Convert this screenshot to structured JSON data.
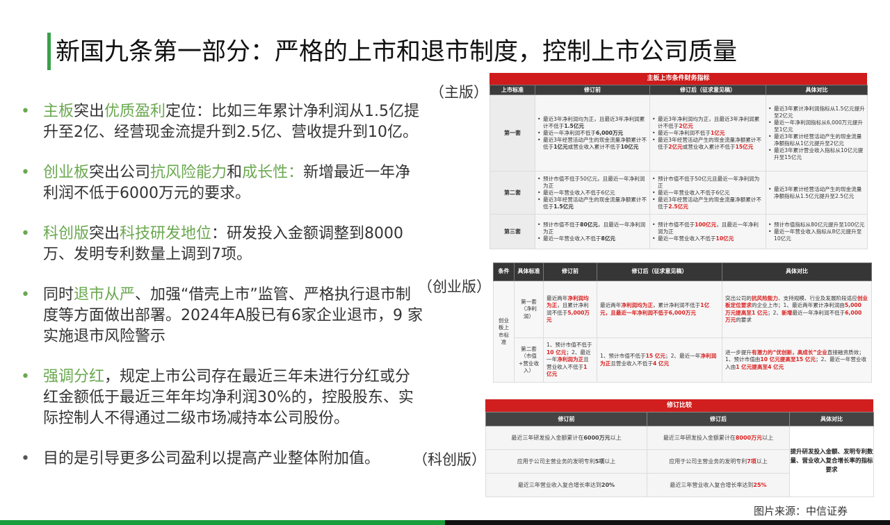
{
  "title": "新国九条第一部分：严格的上市和退市制度，控制上市公司质量",
  "bullets": [
    {
      "segments": [
        {
          "t": "主板",
          "hl": true
        },
        {
          "t": "突出",
          "hl": false
        },
        {
          "t": "优质盈利",
          "hl": true
        },
        {
          "t": "定位：比如三年累计净利润从1.5亿提升至2亿、经营现金流提升到2.5亿、营收提升到10亿。",
          "hl": false
        }
      ]
    },
    {
      "segments": [
        {
          "t": "创业板",
          "hl": true
        },
        {
          "t": "突出公司",
          "hl": false
        },
        {
          "t": "抗风险能力",
          "hl": true
        },
        {
          "t": "和",
          "hl": false
        },
        {
          "t": "成长性：",
          "hl": true
        },
        {
          "t": "新增最近一年净利润不低于6000万元的要求。",
          "hl": false
        }
      ]
    },
    {
      "segments": [
        {
          "t": "科创版",
          "hl": true
        },
        {
          "t": "突出",
          "hl": false
        },
        {
          "t": "科技研发地位",
          "hl": true
        },
        {
          "t": "：研发投入金额调整到8000万、发明专利数量上调到7项。",
          "hl": false
        }
      ]
    },
    {
      "segments": [
        {
          "t": "同时",
          "hl": false
        },
        {
          "t": "退市从严",
          "hl": true
        },
        {
          "t": "、加强“借壳上市”监管、严格执行退市制度等方面做出部署。2024年A股已有6家企业退市，9 家实施退市风险警示",
          "hl": false
        }
      ]
    },
    {
      "segments": [
        {
          "t": "强调分红",
          "hl": true
        },
        {
          "t": "，规定上市公司存在最近三年未进行分红或分红金额低于最近三年年均净利润30%的，控股股东、实际控制人不得通过二级市场减持本公司股份。",
          "hl": false
        }
      ]
    },
    {
      "plain": true,
      "segments": [
        {
          "t": "目的是引导更多公司盈利以提高产业整体附加值。",
          "hl": false
        }
      ]
    }
  ],
  "labels": {
    "main": "（主版）",
    "cyb": "（创业版）",
    "kcb": "（科创版）"
  },
  "source": "图片来源：中信证券",
  "colors": {
    "accent_green": "#6aa84f",
    "table_red": "#cf1b1b",
    "footer_green": "#1a9e3c"
  },
  "main_table": {
    "title": "主板上市条件财务指标",
    "headers": [
      "上市标准",
      "修订前",
      "修订后（征求意见稿）",
      "具体对比"
    ],
    "rows": [
      {
        "label": "第一套",
        "before": [
          [
            {
              "t": "最近3年净利润均为正，且最近3年净利润累计不低于"
            },
            {
              "t": "1.5亿元",
              "b": true
            }
          ],
          [
            {
              "t": "最近一年净利润不低于"
            },
            {
              "t": "6,000万元",
              "b": true
            }
          ],
          [
            {
              "t": "最近3年经营活动产生的现金流量净额累计不低于"
            },
            {
              "t": "1亿元",
              "b": true
            },
            {
              "t": "或营业收入累计不低于"
            },
            {
              "t": "10亿元",
              "b": true
            }
          ]
        ],
        "after": [
          [
            {
              "t": "最近3年净利润均为正，且最近3年净利润累计不低于"
            },
            {
              "t": "2亿元",
              "r": true
            }
          ],
          [
            {
              "t": "最近一年净利润不低于"
            },
            {
              "t": "1亿元",
              "r": true
            }
          ],
          [
            {
              "t": "最近3年经营活动产生的现金流量净额累计不低于"
            },
            {
              "t": "2亿元",
              "r": true
            },
            {
              "t": "或营业收入累计不低于"
            },
            {
              "t": "15亿元",
              "r": true
            }
          ]
        ],
        "compare": [
          "最近3年累计净利润指标从1.5亿元提升至2亿元",
          "最近一年净利润指标从6,000万元提升至1亿元",
          "最近3年累计经营活动产生的现金流量净额指标从1亿元提升至2亿元",
          "最近3年累计营业收入指标从10亿元提升至15亿元"
        ]
      },
      {
        "label": "第二套",
        "before": [
          [
            {
              "t": "预计市值不低于50亿元，且最近一年净利润为正"
            }
          ],
          [
            {
              "t": "最近一年营业收入不低于6亿元"
            }
          ],
          [
            {
              "t": "最近3年经营活动产生的现金流量净额累计不低于"
            },
            {
              "t": "1.5亿元",
              "b": true
            }
          ]
        ],
        "after": [
          [
            {
              "t": "预计市值不低于50亿元且最近一年净利润为正"
            }
          ],
          [
            {
              "t": "最近一年营业收入不低于6亿元"
            }
          ],
          [
            {
              "t": "最近3年经营活动产生的现金流量净额累计不低于"
            },
            {
              "t": "2.5亿元",
              "r": true
            }
          ]
        ],
        "compare": [
          "最近3年累计经营活动产生的现金流量净额指标从1.5亿元提升至2.5亿元"
        ]
      },
      {
        "label": "第三套",
        "before": [
          [
            {
              "t": "预计市值不低于"
            },
            {
              "t": "80亿元",
              "b": true
            },
            {
              "t": "，且最近一年净利润为正"
            }
          ],
          [
            {
              "t": "最近一年营业收入不低于"
            },
            {
              "t": "8亿元",
              "b": true
            }
          ]
        ],
        "after": [
          [
            {
              "t": "预计市值不低于"
            },
            {
              "t": "100亿元",
              "r": true
            },
            {
              "t": "，且最近一年净利润为正"
            }
          ],
          [
            {
              "t": "最近一年营业收入不低于"
            },
            {
              "t": "10亿元",
              "r": true
            }
          ]
        ],
        "compare": [
          "预计市值指标从80亿元提升至100亿元",
          "最近一年营业收入指标从8亿元提升至10亿元"
        ]
      }
    ]
  },
  "cyb_table": {
    "headers": [
      "条件",
      "具体标准",
      "修订前",
      "修订后（征求意见稿）",
      "具体对比"
    ],
    "condition": "创业板上市标准",
    "rows": [
      {
        "std": "第一套（净利润）",
        "before": [
          {
            "t": "最近两年"
          },
          {
            "t": "净利润均为正",
            "r": true
          },
          {
            "t": "，且累计净利润不低于"
          },
          {
            "t": "5,000万元",
            "r": true
          }
        ],
        "after": [
          {
            "t": "最近两年"
          },
          {
            "t": "净利润均为正",
            "r": true
          },
          {
            "t": "，累计净利润不低于"
          },
          {
            "t": "1亿元，且最近一年净利润不低于6,000万元",
            "r": true
          }
        ],
        "compare": [
          {
            "t": "突出公司的"
          },
          {
            "t": "抗风险能力",
            "r": true
          },
          {
            "t": "、支持规模、行业及发展阶段适应"
          },
          {
            "t": "创业板定位要求",
            "r": true
          },
          {
            "t": "的企业上市；1、最近两年累计净利润由"
          },
          {
            "t": "5,000 万元提高至1 亿元",
            "r": true
          },
          {
            "t": "；2、"
          },
          {
            "t": "新增",
            "r": true
          },
          {
            "t": "最近一年净利润不低于"
          },
          {
            "t": "6,000 万元",
            "r": true
          },
          {
            "t": "的要求"
          }
        ]
      },
      {
        "std": "第二套（市值+营业收入）",
        "before": [
          {
            "t": "1、预计市值不低于"
          },
          {
            "t": "10 亿元",
            "r": true
          },
          {
            "t": "；2、最近一年"
          },
          {
            "t": "净利润为正",
            "r": true
          },
          {
            "t": "且营业收入不低于"
          },
          {
            "t": "1 亿元",
            "r": true
          }
        ],
        "after": [
          {
            "t": "1、预计市值不低于"
          },
          {
            "t": "15 亿元",
            "r": true
          },
          {
            "t": "；2、最近一年"
          },
          {
            "t": "净利润为正",
            "r": true
          },
          {
            "t": "且营业收入不低于"
          },
          {
            "t": "4 亿元",
            "r": true
          }
        ],
        "compare": [
          {
            "t": "进一步提升"
          },
          {
            "t": "有潜力的“优创新，高成长”企业",
            "r": true
          },
          {
            "t": "直接融资质效；1、预计市值由"
          },
          {
            "t": "10 亿元提高至15 亿元",
            "r": true
          },
          {
            "t": "；2、最近一年营业收入由"
          },
          {
            "t": "1 亿元提高至4 亿元",
            "r": true
          }
        ]
      }
    ]
  },
  "kcb_table": {
    "title": "修订比较",
    "headers": [
      "修订前",
      "修订后",
      "具体对比"
    ],
    "rows": [
      {
        "before": [
          {
            "t": "最近三年研发投入金额累计在"
          },
          {
            "t": "6000万元",
            "b": true
          },
          {
            "t": "以上"
          }
        ],
        "after": [
          {
            "t": "最近三年研发投入金额累计在"
          },
          {
            "t": "8000万元",
            "r": true
          },
          {
            "t": "以上"
          }
        ]
      },
      {
        "before": [
          {
            "t": "应用于公司主营业务的发明专利"
          },
          {
            "t": "5项",
            "b": true
          },
          {
            "t": "以上"
          }
        ],
        "after": [
          {
            "t": "应用于公司主营业务的发明专利"
          },
          {
            "t": "7项",
            "r": true
          },
          {
            "t": "以上"
          }
        ]
      },
      {
        "before": [
          {
            "t": "最近三年营业收入复合增长率达到"
          },
          {
            "t": "20%",
            "b": true
          }
        ],
        "after": [
          {
            "t": "最近三年营业收入复合增长率达到"
          },
          {
            "t": "25%",
            "r": true
          }
        ]
      }
    ],
    "compare": "提升研发投入金额、发明专利数量、营业收入复合增长率的指标要求"
  }
}
